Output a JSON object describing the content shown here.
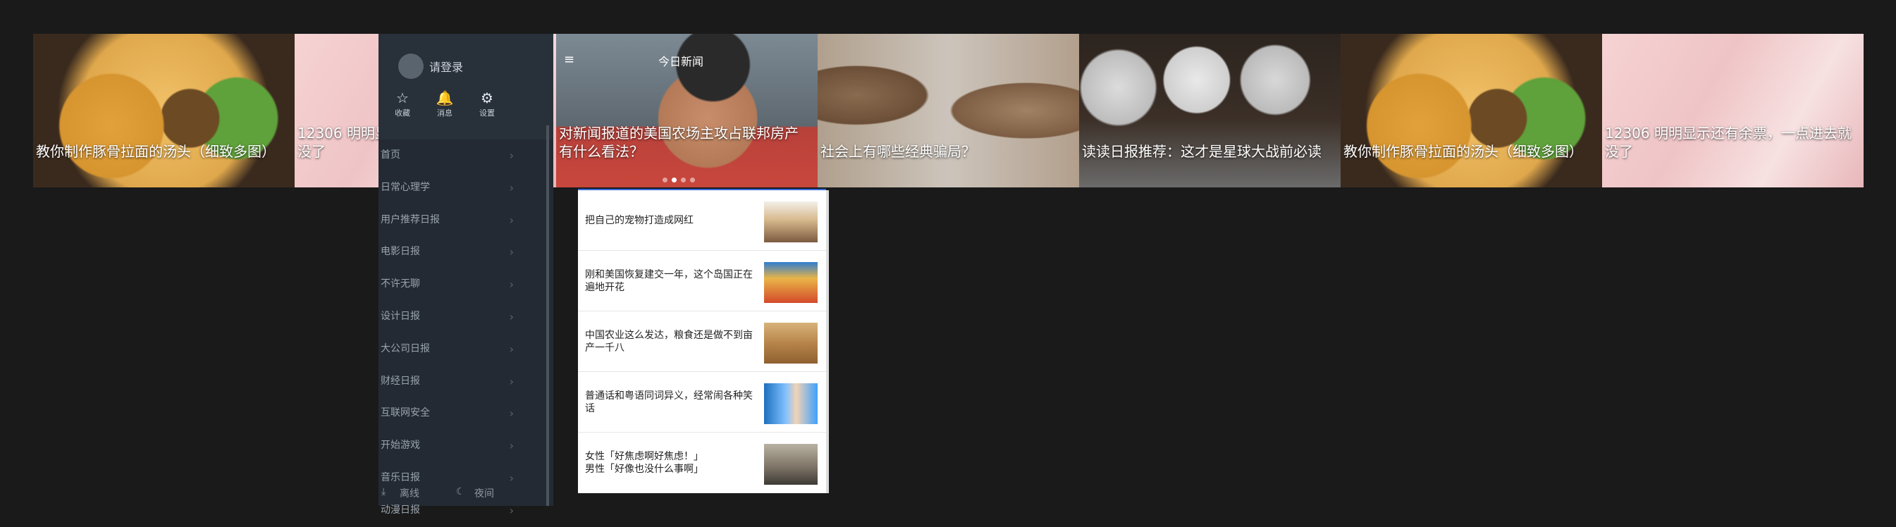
{
  "banner": {
    "slides": [
      {
        "caption": "教你制作豚骨拉面的汤头（细致多图）"
      },
      {
        "caption": "12306 明明显示还有余票，一点进去就没了"
      },
      {
        "caption": "对新闻报道的美国农场主攻占联邦房产有什么看法？"
      },
      {
        "caption": "社会上有哪些经典骗局？"
      },
      {
        "caption": "读读日报推荐：这才是星球大战前必读"
      },
      {
        "caption": "教你制作豚骨拉面的汤头（细致多图）"
      },
      {
        "caption": "12306 明明显示还有余票，一点进去就没了"
      }
    ]
  },
  "drawer": {
    "login": "请登录",
    "quick": [
      {
        "icon": "star-icon",
        "glyph": "☆",
        "label": "收藏"
      },
      {
        "icon": "bell-icon",
        "glyph": "🔔",
        "label": "消息"
      },
      {
        "icon": "gear-icon",
        "glyph": "⚙",
        "label": "设置"
      }
    ],
    "menu": [
      "首页",
      "日常心理学",
      "用户推荐日报",
      "电影日报",
      "不许无聊",
      "设计日报",
      "大公司日报",
      "财经日报",
      "互联网安全",
      "开始游戏",
      "音乐日报",
      "动漫日报"
    ],
    "footer": {
      "offline": "离线",
      "night": "夜间"
    }
  },
  "today": {
    "title": "今日新闻",
    "list": [
      {
        "title": "把自己的宠物打造成网红"
      },
      {
        "title": "刚和美国恢复建交一年，这个岛国正在遍地开花"
      },
      {
        "title": "中国农业这么发达，粮食还是做不到亩产一千八"
      },
      {
        "title": "普通话和粤语同词异义，经常闹各种笑话"
      },
      {
        "title": "女性「好焦虑啊好焦虑！」\n男性「好像也没什么事啊」"
      }
    ]
  },
  "colors": {
    "accent": "#3c6bd9",
    "drawer_bg": "#232a33"
  }
}
